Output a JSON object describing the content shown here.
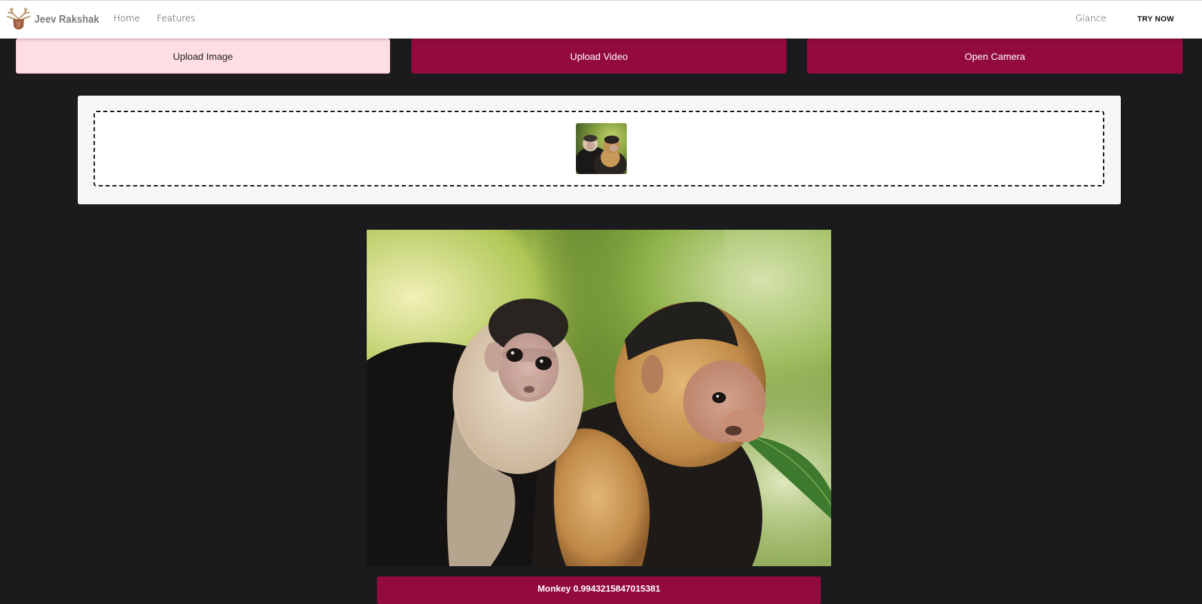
{
  "navbar": {
    "brand": "Jeev Rakshak",
    "links": {
      "home": "Home",
      "features": "Features",
      "glance": "Glance"
    },
    "cta": "TRY NOW"
  },
  "actions": {
    "upload_image": "Upload Image",
    "upload_video": "Upload Video",
    "open_camera": "Open Camera"
  },
  "result": {
    "label": "Monkey",
    "confidence": "0.9943215847015381",
    "text": "Monkey 0.9943215847015381"
  },
  "colors": {
    "primary": "#930a3f",
    "active_button": "#ffdde5",
    "background": "#1b1b1d",
    "panel": "#f7f6f4"
  },
  "icons": {
    "brand": "deer-antler-shield-logo"
  }
}
